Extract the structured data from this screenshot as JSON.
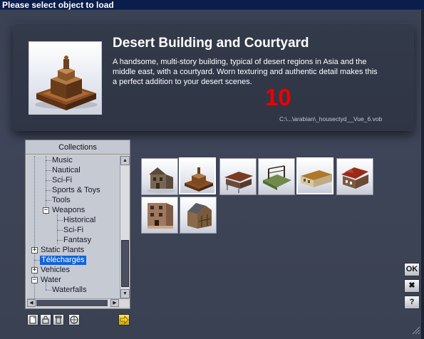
{
  "window": {
    "title": "Please select object to load"
  },
  "preview": {
    "title": "Desert Building and Courtyard",
    "description": "A handsome, multi-story building, typical of desert regions in Asia and the middle east, with a courtyard. Worn texturing and authentic detail makes this a perfect addition to your desert scenes.",
    "number": "10",
    "path": "C:\\...\\arabian\\_housectyd__Vue_6.vob"
  },
  "collections": {
    "header": "Collections",
    "items": [
      {
        "label": "Music"
      },
      {
        "label": "Nautical"
      },
      {
        "label": "Sci-Fi"
      },
      {
        "label": "Sports & Toys"
      },
      {
        "label": "Tools"
      },
      {
        "label": "Weapons",
        "expanded": true
      },
      {
        "label": "Historical"
      },
      {
        "label": "Sci-Fi"
      },
      {
        "label": "Fantasy"
      },
      {
        "label": "Static Plants",
        "expanded": false
      },
      {
        "label": "Téléchargés",
        "selected": true
      },
      {
        "label": "Vehicles",
        "expanded": false
      },
      {
        "label": "Water",
        "expanded": true
      },
      {
        "label": "Waterfalls"
      }
    ]
  },
  "toolbar": {
    "icons": [
      "new-collection-icon",
      "lock-icon",
      "trash-icon",
      "globe-icon",
      "arrow-right-icon"
    ]
  },
  "thumbnails": [
    {
      "name": "house-thumbnail"
    },
    {
      "name": "desert-building-thumbnail",
      "selected": true
    },
    {
      "name": "ruined-shack-thumbnail"
    },
    {
      "name": "scaffold-thumbnail"
    },
    {
      "name": "long-building-thumbnail"
    },
    {
      "name": "red-roof-house-thumbnail"
    },
    {
      "name": "stone-building-thumbnail"
    },
    {
      "name": "barn-thumbnail"
    }
  ],
  "buttons": {
    "ok": "OK",
    "close": "✖",
    "help": "?"
  },
  "colors": {
    "titlebar": "#0b1d4a",
    "background": "#3d4456",
    "selection": "#0a64e0",
    "number": "#ee0000"
  }
}
